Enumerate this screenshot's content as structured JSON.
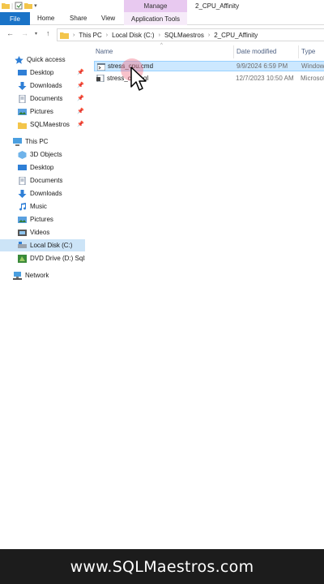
{
  "window": {
    "title": "2_CPU_Affinity",
    "contextual_tab_group": "Manage"
  },
  "ribbon": {
    "tabs": [
      "File",
      "Home",
      "Share",
      "View"
    ],
    "contextual_tab": "Application Tools"
  },
  "address_bar": {
    "crumbs": [
      "This PC",
      "Local Disk (C:)",
      "SQLMaestros",
      "2_CPU_Affinity"
    ]
  },
  "nav_pane": {
    "quick_access": {
      "label": "Quick access",
      "items": [
        "Desktop",
        "Downloads",
        "Documents",
        "Pictures",
        "SQLMaestros"
      ]
    },
    "this_pc": {
      "label": "This PC",
      "items": [
        "3D Objects",
        "Desktop",
        "Documents",
        "Downloads",
        "Music",
        "Pictures",
        "Videos",
        "Local Disk (C:)",
        "DVD Drive (D:) SqlSe"
      ]
    },
    "network": "Network"
  },
  "file_list": {
    "columns": [
      "Name",
      "Date modified",
      "Type"
    ],
    "rows": [
      {
        "name": "stress_cpu.cmd",
        "date": "9/9/2024 6:59 PM",
        "type": "Windows"
      },
      {
        "name": "stress_cpu.sql",
        "date": "12/7/2023 10:50 AM",
        "type": "Microsoft"
      }
    ]
  },
  "banner": {
    "text": "www.SQLMaestros.com"
  },
  "colors": {
    "file_tab": "#1a73c7",
    "manage_tab": "#e8c9f0",
    "selection": "#cce8ff",
    "banner_bg": "#1c1c1c"
  }
}
